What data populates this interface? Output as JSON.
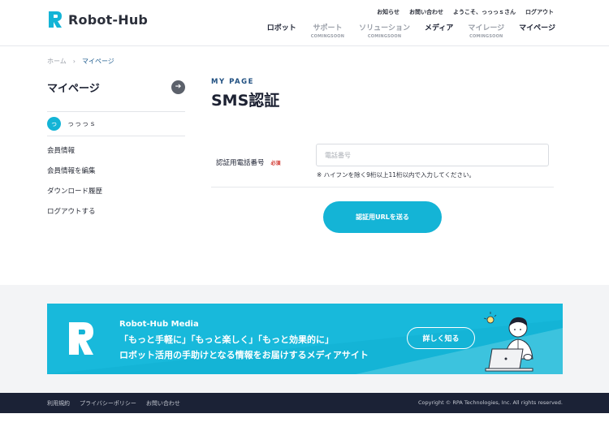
{
  "header": {
    "logo_text": "Robot-Hub",
    "utility_links": [
      "お知らせ",
      "お問い合わせ",
      "ようこそ、っっっｓさん",
      "ログアウト"
    ],
    "nav": [
      {
        "label": "ロボット",
        "sub": "",
        "disabled": false
      },
      {
        "label": "サポート",
        "sub": "COMINGSOON",
        "disabled": true
      },
      {
        "label": "ソリューション",
        "sub": "COMINGSOON",
        "disabled": true
      },
      {
        "label": "メディア",
        "sub": "",
        "disabled": false
      },
      {
        "label": "マイレージ",
        "sub": "COMINGSOON",
        "disabled": true
      },
      {
        "label": "マイページ",
        "sub": "",
        "disabled": false
      }
    ]
  },
  "breadcrumb": {
    "home": "ホーム",
    "separator": "›",
    "current": "マイページ"
  },
  "sidebar": {
    "title": "マイページ",
    "arrow_icon": "arrow-right-icon",
    "avatar_initial": "っ",
    "username": "っっっｓ",
    "menu": [
      "会員情報",
      "会員情報を編集",
      "ダウンロード履歴",
      "ログアウトする"
    ]
  },
  "main": {
    "eyebrow": "MY PAGE",
    "title": "SMS認証",
    "field_label": "認証用電話番号",
    "required_badge": "必須",
    "phone_placeholder": "電話番号",
    "phone_value": "",
    "note": "※ ハイフンを除く9桁以上11桁以内で入力してください。",
    "submit_label": "認証用URLを送る"
  },
  "banner": {
    "brand": "Robot-Hub Media",
    "line1": "「もっと手軽に」「もっと楽しく」「もっと効果的に」",
    "line2": "ロボット活用の手助けとなる情報をお届けするメディアサイト",
    "button_label": "詳しく知る"
  },
  "footer": {
    "links": [
      "利用規約",
      "プライバシーポリシー",
      "お問い合わせ"
    ],
    "copyright": "Copyright © RPA Technologies, Inc. All rights reserved."
  },
  "colors": {
    "accent": "#14b4d6",
    "navy": "#1b2236",
    "required": "#d0342c"
  }
}
